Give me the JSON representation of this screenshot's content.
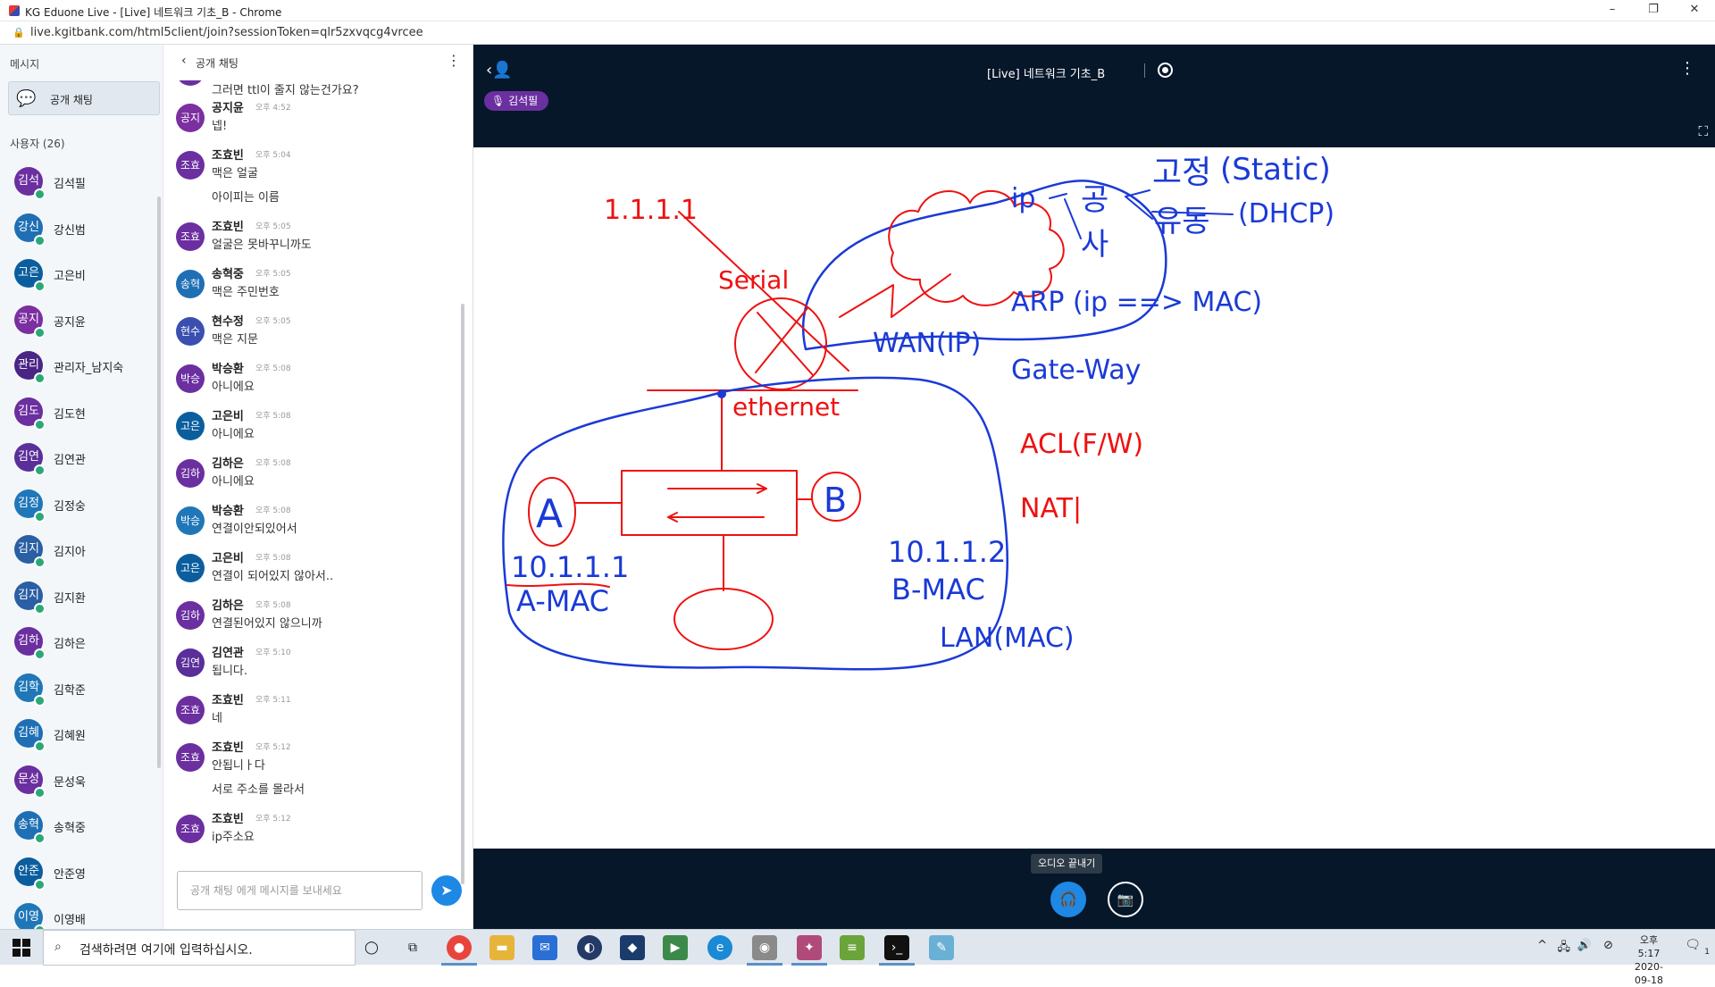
{
  "browser": {
    "title": "KG Eduone Live - [Live] 네트워크 기초_B - Chrome",
    "url": "live.kgitbank.com/html5client/join?sessionToken=qlr5zxvqcg4vrcee"
  },
  "messages_panel": {
    "header": "메시지",
    "public_chat_label": "공개 채팅",
    "users_header": "사용자 (26)"
  },
  "users": [
    {
      "initials": "김석",
      "name": "김석필",
      "color": "#6b2fa0"
    },
    {
      "initials": "강신",
      "name": "강신범",
      "color": "#1f6fb5"
    },
    {
      "initials": "고은",
      "name": "고은비",
      "color": "#0b5e9e"
    },
    {
      "initials": "공지",
      "name": "공지윤",
      "color": "#7b2fa0"
    },
    {
      "initials": "관리",
      "name": "관리자_남지숙",
      "color": "#4a2585"
    },
    {
      "initials": "김도",
      "name": "김도현",
      "color": "#6b2fa0"
    },
    {
      "initials": "김연",
      "name": "김연관",
      "color": "#5a2f9a"
    },
    {
      "initials": "김정",
      "name": "김정숭",
      "color": "#1f77b8"
    },
    {
      "initials": "김지",
      "name": "김지아",
      "color": "#2a5fa3"
    },
    {
      "initials": "김지",
      "name": "김지환",
      "color": "#2a5fa3"
    },
    {
      "initials": "김하",
      "name": "김하은",
      "color": "#6b2fa0"
    },
    {
      "initials": "김학",
      "name": "김학준",
      "color": "#1f77b8"
    },
    {
      "initials": "김혜",
      "name": "김혜원",
      "color": "#1f6fb5"
    },
    {
      "initials": "문성",
      "name": "문성욱",
      "color": "#6b2fa0"
    },
    {
      "initials": "송혁",
      "name": "송혁중",
      "color": "#1f6fb5"
    },
    {
      "initials": "안준",
      "name": "안준영",
      "color": "#0b5e9e"
    },
    {
      "initials": "이영",
      "name": "이영배",
      "color": "#1f77b8"
    }
  ],
  "chat": {
    "header": "공개 채팅",
    "input_placeholder": "공개 채팅 에게 메시지를 보내세요",
    "top_partial_text": "그러면 ttl이 줄지 않는건가요?",
    "messages": [
      {
        "initials": "공지",
        "name": "공지윤",
        "time": "오후 4:52",
        "lines": [
          "넵!"
        ],
        "color": "#7b2fa0"
      },
      {
        "initials": "조효",
        "name": "조효빈",
        "time": "오후 5:04",
        "lines": [
          "맥은 얼굴",
          "아이피는 이름"
        ],
        "color": "#6b2fa0"
      },
      {
        "initials": "조효",
        "name": "조효빈",
        "time": "오후 5:05",
        "lines": [
          "얼굴은 못바꾸니까도"
        ],
        "color": "#6b2fa0"
      },
      {
        "initials": "송혁",
        "name": "송혁중",
        "time": "오후 5:05",
        "lines": [
          "맥은 주민번호"
        ],
        "color": "#1f6fb5"
      },
      {
        "initials": "현수",
        "name": "현수정",
        "time": "오후 5:05",
        "lines": [
          "맥은 지문"
        ],
        "color": "#3a4fb0"
      },
      {
        "initials": "박승",
        "name": "박승환",
        "time": "오후 5:08",
        "lines": [
          "아니에요"
        ],
        "color": "#6b2fa0"
      },
      {
        "initials": "고은",
        "name": "고은비",
        "time": "오후 5:08",
        "lines": [
          "아니에요"
        ],
        "color": "#0b5e9e"
      },
      {
        "initials": "김하",
        "name": "김하은",
        "time": "오후 5:08",
        "lines": [
          "아니에요"
        ],
        "color": "#6b2fa0"
      },
      {
        "initials": "박승",
        "name": "박승환",
        "time": "오후 5:08",
        "lines": [
          "연결이안되있어서"
        ],
        "color": "#1f77b8"
      },
      {
        "initials": "고은",
        "name": "고은비",
        "time": "오후 5:08",
        "lines": [
          "연결이 되어있지 않아서.."
        ],
        "color": "#0b5e9e"
      },
      {
        "initials": "김하",
        "name": "김하은",
        "time": "오후 5:08",
        "lines": [
          "연결된어있지 않으니까"
        ],
        "color": "#6b2fa0"
      },
      {
        "initials": "김연",
        "name": "김연관",
        "time": "오후 5:10",
        "lines": [
          "됩니다."
        ],
        "color": "#5a2f9a"
      },
      {
        "initials": "조효",
        "name": "조효빈",
        "time": "오후 5:11",
        "lines": [
          "네"
        ],
        "color": "#6b2fa0"
      },
      {
        "initials": "조효",
        "name": "조효빈",
        "time": "오후 5:12",
        "lines": [
          "안됩니ㅏ다",
          "서로 주소를 몰라서"
        ],
        "color": "#6b2fa0"
      },
      {
        "initials": "조효",
        "name": "조효빈",
        "time": "오후 5:12",
        "lines": [
          "ip주소요"
        ],
        "color": "#6b2fa0"
      }
    ]
  },
  "session": {
    "title": "[Live] 네트워크 기초_B",
    "talker": "김석필"
  },
  "whiteboard": {
    "red": {
      "ip_top": "1.1.1.1",
      "serial": "Serial",
      "ethernet": "ethernet",
      "acl": "ACL(F/W)",
      "nat": "NAT|"
    },
    "blue": {
      "wan": "WAN(IP)",
      "lan": "LAN(MAC)",
      "ip_a": "10.1.1.1",
      "mac_a": "A-MAC",
      "ip_b": "10.1.1.2",
      "mac_b": "B-MAC",
      "node_a": "A",
      "node_b": "B",
      "ip_word": "ip",
      "gong": "공",
      "sa": "사",
      "gojeong": "고정",
      "static": "(Static)",
      "yudong": "유동",
      "dhcp": "(DHCP)",
      "arp": "ARP (ip ==> MAC)",
      "gateway": "Gate-Way"
    }
  },
  "controls": {
    "audio_tooltip": "오디오 끝내기"
  },
  "taskbar": {
    "search_placeholder": "검색하려면 여기에 입력하십시오.",
    "time": "오후 5:17",
    "date": "2020-09-18",
    "notifications": "1"
  }
}
